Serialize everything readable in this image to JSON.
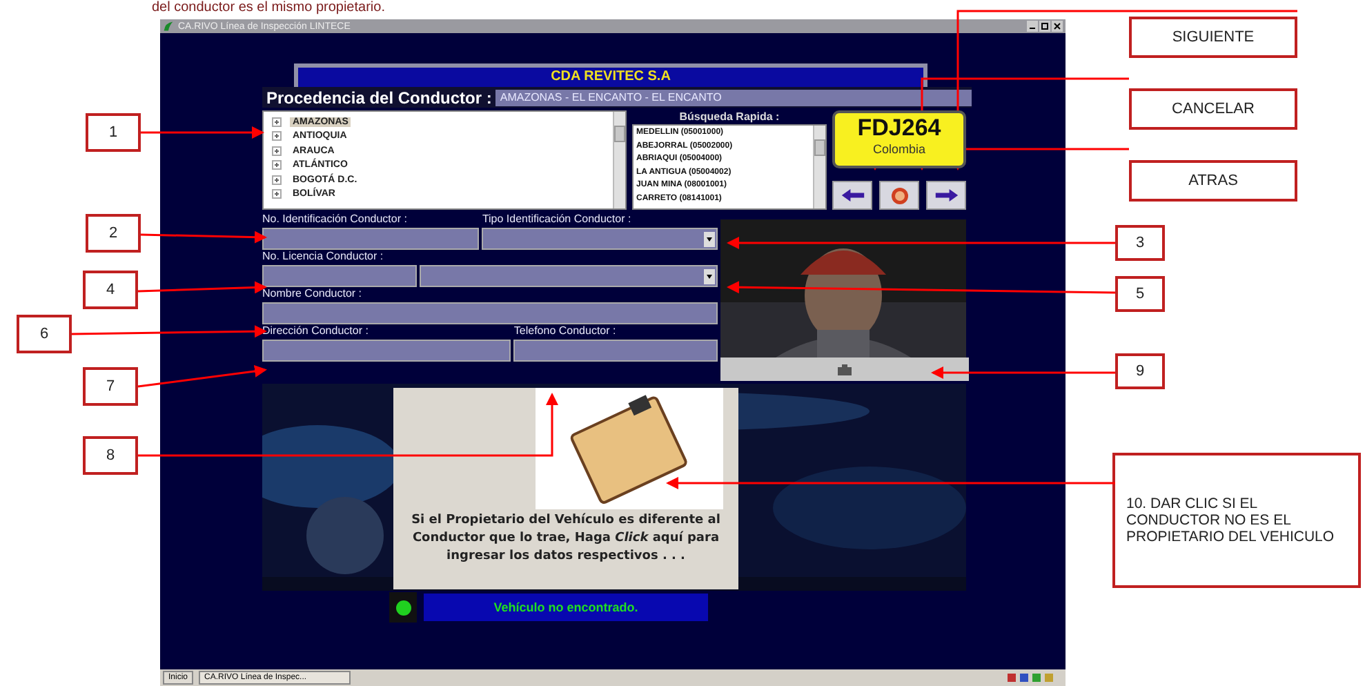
{
  "document": {
    "intro_text": "del conductor es el mismo propietario.",
    "callouts": [
      {
        "label": "1"
      },
      {
        "label": "2"
      },
      {
        "label": "4"
      },
      {
        "label": "6"
      },
      {
        "label": "7"
      },
      {
        "label": "8"
      },
      {
        "label": "3"
      },
      {
        "label": "5"
      },
      {
        "label": "9"
      },
      {
        "label": "SIGUIENTE"
      },
      {
        "label": "CANCELAR"
      },
      {
        "label": "ATRAS"
      },
      {
        "label": "10. DAR CLIC SI EL CONDUCTOR  NO ES EL PROPIETARIO DEL VEHICULO"
      }
    ]
  },
  "window": {
    "title": "CA.RIVO Línea de Inspección LINTECE",
    "company": "CDA REVITEC S.A",
    "origin": {
      "label": "Procedencia del Conductor :",
      "value": "AMAZONAS - EL ENCANTO - EL ENCANTO"
    },
    "tree": {
      "items": [
        {
          "label": "AMAZONAS",
          "selected": true
        },
        {
          "label": "ANTIOQUIA",
          "selected": false
        },
        {
          "label": "ARAUCA",
          "selected": false
        },
        {
          "label": "ATLÁNTICO",
          "selected": false
        },
        {
          "label": "BOGOTÁ D.C.",
          "selected": false
        },
        {
          "label": "BOLÍVAR",
          "selected": false
        }
      ]
    },
    "quick_search": {
      "label": "Búsqueda Rapida :",
      "items": [
        "MEDELLIN (05001000)",
        "ABEJORRAL (05002000)",
        "ABRIAQUI (05004000)",
        "LA ANTIGUA (05004002)",
        "JUAN MINA (08001001)",
        "CARRETO (08141001)"
      ]
    },
    "plate": {
      "number": "FDJ264",
      "country": "Colombia"
    },
    "form": {
      "rows": [
        [
          {
            "label": "No. Identificación Conductor :",
            "kind": "text"
          },
          {
            "label": "Tipo Identificación Conductor :",
            "kind": "dropdown"
          }
        ],
        [
          {
            "label": "No. Licencia Conductor :",
            "kind": "text"
          },
          {
            "kind": "dropdown"
          }
        ],
        [
          {
            "label": "Nombre Conductor :",
            "kind": "text"
          }
        ],
        [
          {
            "label": "Dirección Conductor :",
            "kind": "text"
          },
          {
            "label": "Telefono Conductor :",
            "kind": "text"
          }
        ]
      ]
    },
    "popup": {
      "text": "Si el Propietario del Vehículo es diferente al Conductor que lo trae, Haga *Click* aquí para ingresar los datos respectivos . . ."
    },
    "status": "Vehículo no encontrado.",
    "taskbar": {
      "start": "Inicio",
      "task": "CA.RIVO Línea de Inspec..."
    }
  }
}
